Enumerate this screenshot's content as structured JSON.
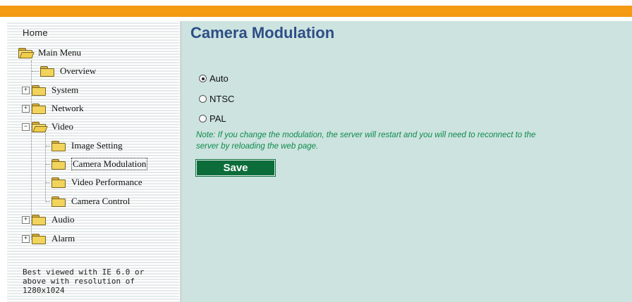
{
  "header": {
    "accent_color": "#f49a13"
  },
  "sidebar": {
    "home_label": "Home",
    "main_menu": {
      "label": "Main Menu",
      "icon": "open-folder-icon"
    },
    "items": [
      {
        "label": "Overview",
        "expandable": false
      },
      {
        "label": "System",
        "expandable": true,
        "expand_symbol": "+"
      },
      {
        "label": "Network",
        "expandable": true,
        "expand_symbol": "+"
      },
      {
        "label": "Video",
        "expandable": true,
        "expand_symbol": "−",
        "expanded": true,
        "children": [
          {
            "label": "Image Setting"
          },
          {
            "label": "Camera Modulation",
            "selected": true
          },
          {
            "label": "Video Performance"
          },
          {
            "label": "Camera Control"
          }
        ]
      },
      {
        "label": "Audio",
        "expandable": true,
        "expand_symbol": "+"
      },
      {
        "label": "Alarm",
        "expandable": true,
        "expand_symbol": "+"
      }
    ],
    "footnote_lines": [
      "Best viewed with IE 6.0 or",
      "above with resolution of",
      "1280x1024"
    ]
  },
  "main": {
    "title": "Camera Modulation",
    "options": [
      {
        "label": "Auto",
        "checked": true
      },
      {
        "label": "NTSC",
        "checked": false
      },
      {
        "label": "PAL",
        "checked": false
      }
    ],
    "note_line1": "Note: If you change the modulation, the server will restart and you will need to reconnect to the",
    "note_line2": "server by reloading the web page.",
    "save_label": "Save",
    "colors": {
      "background": "#cde3df",
      "title": "#2e4e86",
      "note": "#0c8b4c",
      "button": "#0c6d3a"
    }
  }
}
